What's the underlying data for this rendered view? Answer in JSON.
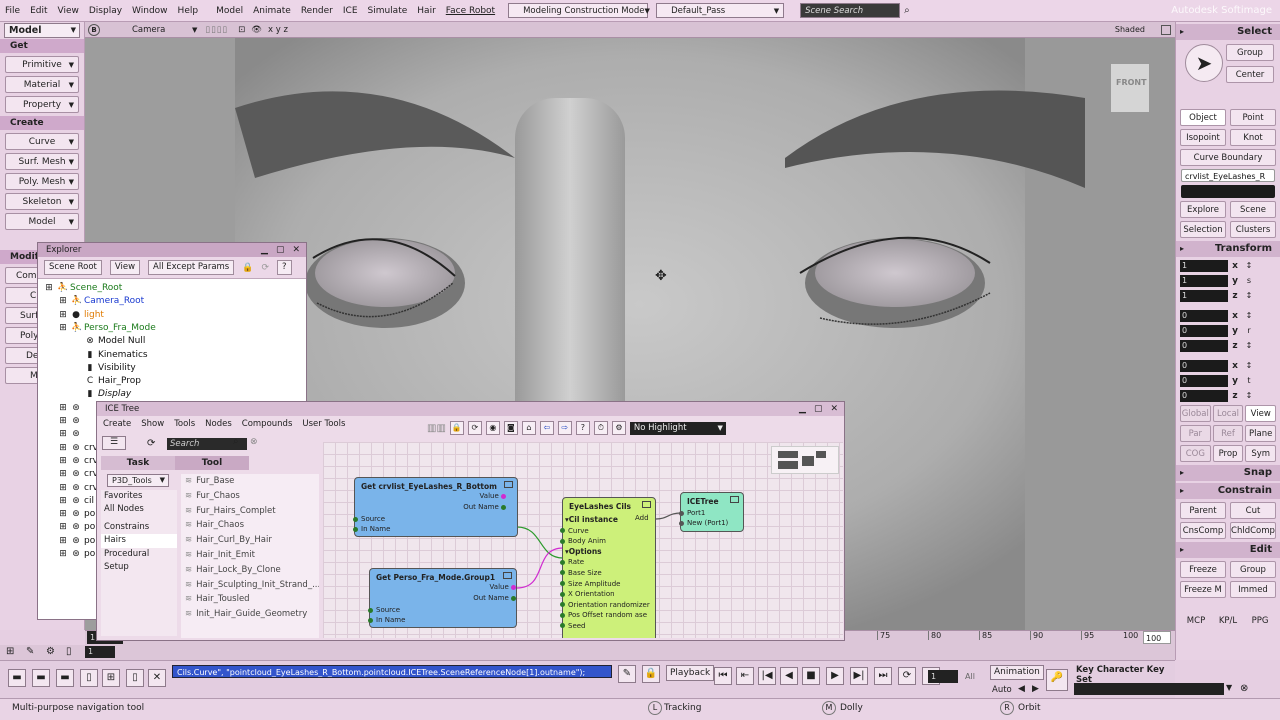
{
  "menubar": {
    "items": [
      "File",
      "Edit",
      "View",
      "Display",
      "Window",
      "Help",
      "Model",
      "Animate",
      "Render",
      "ICE",
      "Simulate",
      "Hair",
      "Face Robot"
    ],
    "construction_mode": "Modeling Construction Mode",
    "pass": "Default_Pass",
    "search_placeholder": "Scene Search",
    "brand": "Autodesk Softimage"
  },
  "left": {
    "mode": "Model",
    "sections": [
      {
        "title": "Get",
        "buttons": [
          "Primitive",
          "Material",
          "Property"
        ]
      },
      {
        "title": "Create",
        "buttons": [
          "Curve",
          "Surf. Mesh",
          "Poly. Mesh",
          "Skeleton",
          "Model"
        ]
      },
      {
        "title": "Modify",
        "buttons": [
          "Com",
          "C",
          "Surf",
          "Poly",
          "De",
          "M"
        ]
      }
    ]
  },
  "viewport": {
    "label": "B",
    "camera": "Camera",
    "axes": "x y z",
    "shading": "Shaded",
    "view_cube": "FRONT"
  },
  "explorer": {
    "title": "Explorer",
    "toolbar": [
      "Scene Root",
      "View",
      "All Except Params"
    ],
    "tree": [
      {
        "label": "Scene_Root",
        "color": "#1a7a1a",
        "indent": 0
      },
      {
        "label": "Camera_Root",
        "color": "#1a3ad0",
        "indent": 1
      },
      {
        "label": "light",
        "color": "#e07a00",
        "indent": 1
      },
      {
        "label": "Perso_Fra_Mode",
        "color": "#1a7a1a",
        "indent": 1
      },
      {
        "label": "Model Null",
        "color": "#111",
        "indent": 2
      },
      {
        "label": "Kinematics",
        "color": "#111",
        "indent": 2
      },
      {
        "label": "Visibility",
        "color": "#111",
        "indent": 2
      },
      {
        "label": "Hair_Prop",
        "color": "#111",
        "indent": 2
      },
      {
        "label": "Display",
        "color": "#111",
        "indent": 2
      },
      {
        "label": "",
        "color": "#111",
        "indent": 1
      },
      {
        "label": "",
        "color": "#111",
        "indent": 1
      },
      {
        "label": "",
        "color": "#111",
        "indent": 1
      },
      {
        "label": "crv",
        "color": "#111",
        "indent": 1
      },
      {
        "label": "crv",
        "color": "#111",
        "indent": 1
      },
      {
        "label": "crv",
        "color": "#111",
        "indent": 1
      },
      {
        "label": "crv",
        "color": "#111",
        "indent": 1
      },
      {
        "label": "cil",
        "color": "#111",
        "indent": 1
      },
      {
        "label": "po",
        "color": "#111",
        "indent": 1
      },
      {
        "label": "po",
        "color": "#111",
        "indent": 1
      },
      {
        "label": "po",
        "color": "#111",
        "indent": 1
      },
      {
        "label": "po",
        "color": "#111",
        "indent": 1
      }
    ]
  },
  "ice": {
    "title": "ICE Tree",
    "menu": [
      "Create",
      "Show",
      "Tools",
      "Nodes",
      "Compounds",
      "User Tools"
    ],
    "highlight": "No Highlight",
    "search_placeholder": "Search",
    "tabs": [
      "Task",
      "Tool"
    ],
    "tool_combo": "P3D_Tools",
    "categories": [
      "Favorites",
      "All Nodes",
      "Constrains",
      "Hairs",
      "Procedural",
      "Setup"
    ],
    "selected_category": "Hairs",
    "tools": [
      "Fur_Base",
      "Fur_Chaos",
      "Fur_Hairs_Complet",
      "Hair_Chaos",
      "Hair_Curl_By_Hair",
      "Hair_Init_Emit",
      "Hair_Lock_By_Clone",
      "Hair_Sculpting_Init_Strand_...",
      "Hair_Tousled",
      "Init_Hair_Guide_Geometry"
    ],
    "nodes": {
      "get_curve": {
        "title": "Get crvlist_EyeLashes_R_Bottom",
        "outputs": [
          "Value",
          "Out Name"
        ],
        "inputs": [
          "Source",
          "In Name"
        ]
      },
      "get_group": {
        "title": "Get Perso_Fra_Mode.Group1",
        "outputs": [
          "Value",
          "Out Name"
        ],
        "inputs": [
          "Source",
          "In Name"
        ]
      },
      "eyelashes": {
        "title": "EyeLashes Cils",
        "group1": "Cil instance",
        "ports1": [
          "Curve",
          "Body Anim"
        ],
        "group2": "Options",
        "ports2": [
          "Rate",
          "Base Size",
          "Size Amplitude",
          "X Orientation",
          "Orientation randomizer",
          "Pos Offset random ase",
          "Seed"
        ]
      },
      "icetree": {
        "title": "ICETree",
        "add": "Add",
        "ports": [
          "Port1",
          "New (Port1)"
        ]
      }
    }
  },
  "right": {
    "select_header": "Select",
    "select_buttons": [
      [
        "Group",
        "Center"
      ],
      [
        "Object",
        "Point"
      ],
      [
        "Isopoint",
        "Knot"
      ],
      [
        "Curve Boundary"
      ]
    ],
    "selected_name": "crvlist_EyeLashes_R",
    "nav_buttons": [
      [
        "Explore",
        "Scene"
      ],
      [
        "Selection",
        "Clusters"
      ]
    ],
    "transform_header": "Transform",
    "scale": [
      "1",
      "1",
      "1"
    ],
    "rotate": [
      "0",
      "0",
      "0"
    ],
    "translate": [
      "0",
      "0",
      "0"
    ],
    "ref_buttons": [
      [
        "Global",
        "Local",
        "View"
      ],
      [
        "Par",
        "Ref",
        "Plane"
      ],
      [
        "COG",
        "Prop",
        "Sym"
      ]
    ],
    "snap_header": "Snap",
    "constrain_header": "Constrain",
    "constrain_buttons": [
      [
        "Parent",
        "Cut"
      ],
      [
        "CnsComp",
        "ChldComp"
      ]
    ],
    "edit_header": "Edit",
    "edit_buttons": [
      [
        "Freeze",
        "Group"
      ],
      [
        "Freeze M",
        "Immed"
      ]
    ],
    "bottom_tabs": [
      "MCP",
      "KP/L",
      "PPG"
    ]
  },
  "timeline": {
    "ticks": [
      "75",
      "80",
      "85",
      "90",
      "95"
    ],
    "end": "100",
    "end2": "100",
    "start": "1",
    "start2": "1"
  },
  "playback": {
    "command": "Cils.Curve\", \"pointcloud_EyeLashes_R_Bottom.pointcloud.ICETree.SceneReferenceNode[1].outname\");",
    "playback_label": "Playback",
    "frame": "1",
    "all": "All",
    "animation": "Animation",
    "auto": "Auto",
    "keyset": "Key Character Key Set"
  },
  "status": {
    "message": "Multi-purpose navigation tool",
    "l": "Tracking",
    "m": "Dolly",
    "r": "Orbit"
  }
}
